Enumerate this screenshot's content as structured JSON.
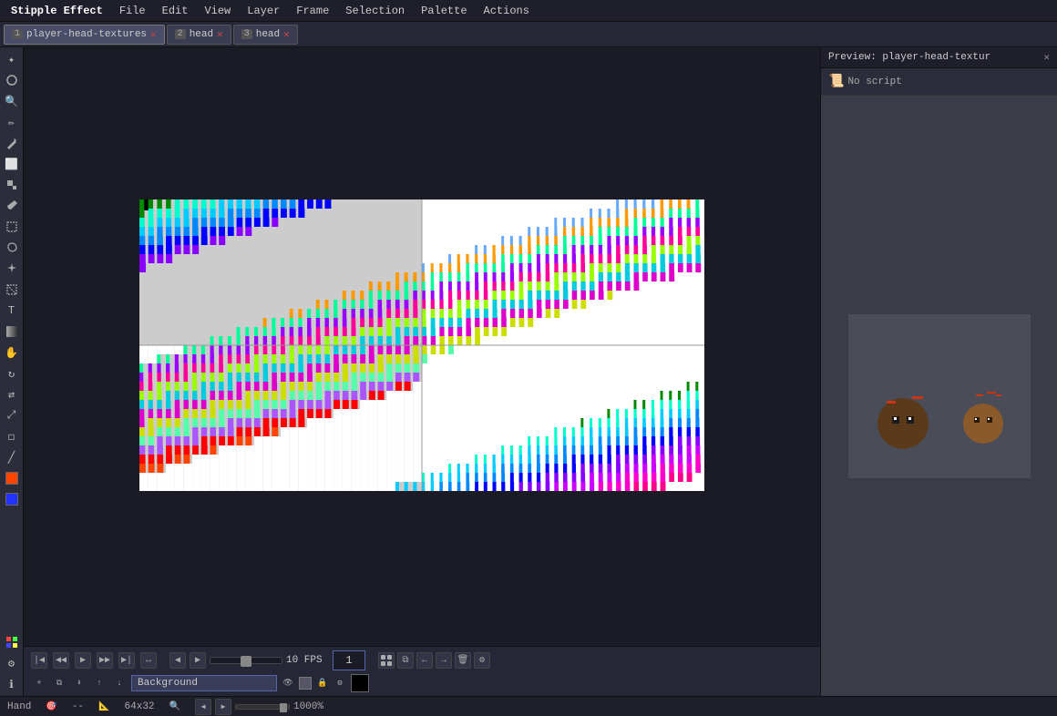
{
  "app": {
    "title": "Stipple Effect"
  },
  "menubar": {
    "items": [
      "Stipple Effect",
      "File",
      "Edit",
      "View",
      "Layer",
      "Frame",
      "Selection",
      "Palette",
      "Actions"
    ]
  },
  "tabs": [
    {
      "num": "1",
      "label": "player-head-textures",
      "active": true
    },
    {
      "num": "2",
      "label": "head",
      "active": false
    },
    {
      "num": "3",
      "label": "head",
      "active": false
    }
  ],
  "timeline": {
    "fps_value": "10 FPS",
    "frame_number": "1"
  },
  "layer": {
    "name": "Background"
  },
  "preview": {
    "title": "Preview: player-head-textur",
    "script_label": "No script"
  },
  "statusbar": {
    "tool": "Hand",
    "coords": "--",
    "dimensions": "64x32",
    "zoom": "1000%"
  },
  "toolbar_icons": [
    "cursor-icon",
    "move-icon",
    "zoom-icon",
    "pencil-icon",
    "brush-icon",
    "eraser-icon",
    "fill-icon",
    "eyedropper-icon",
    "select-icon",
    "lasso-icon",
    "wand-icon",
    "crop-icon",
    "text-icon",
    "gradient-icon",
    "hand-icon",
    "rotate-icon",
    "flip-icon",
    "transform-icon",
    "shapes-icon",
    "line-icon",
    "stamp-icon",
    "smudge-icon"
  ]
}
